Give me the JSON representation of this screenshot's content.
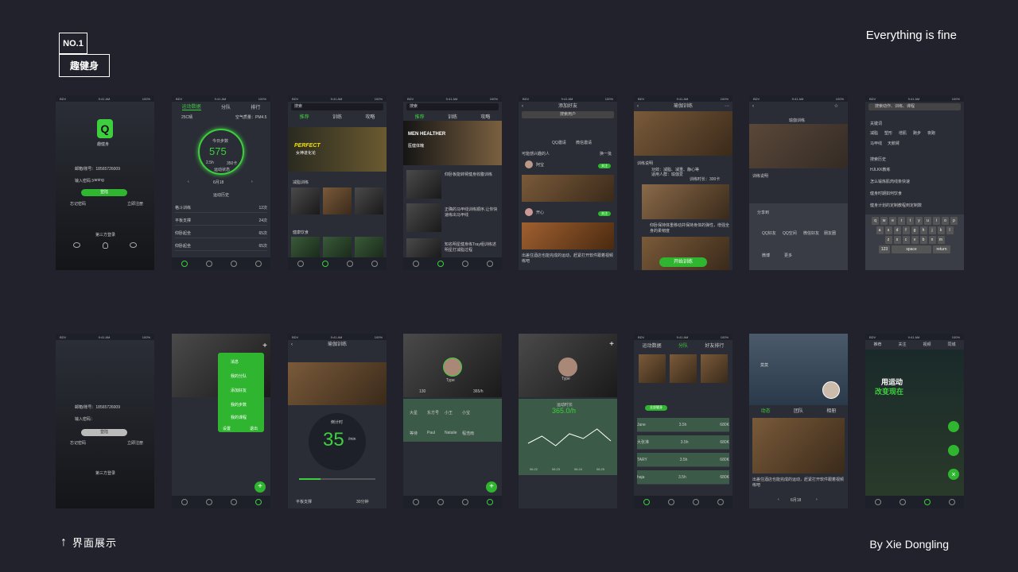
{
  "header": {
    "no_label": "NO.1",
    "app_name": "趣健身",
    "tagline": "Everything is fine"
  },
  "footer": {
    "section_label": "界面展示",
    "author": "By Xie Dongling"
  },
  "status": {
    "carrier": "BDV",
    "time": "9:41 AM",
    "battery": "100%"
  },
  "login": {
    "logo": "Q",
    "app": "趣健身",
    "account": "邮箱/账号：18565726009",
    "password_label": "输入密码：",
    "password": "yaning",
    "login_btn": "登陆",
    "forgot": "忘记密码",
    "register": "立即注册",
    "third": "第三方登录"
  },
  "stats": {
    "tabs": [
      "运动数据",
      "分队",
      "排行"
    ],
    "weather": "25C晴",
    "air": "空气质量：PM4.5",
    "today": "今日步数",
    "steps": "575",
    "dist": "2.5h",
    "cal": "350卡",
    "mode": "运动状态",
    "date": "6月18",
    "history": "运动历史",
    "items": [
      {
        "n": "格斗训练",
        "v": "12次"
      },
      {
        "n": "平板支撑",
        "v": "24次"
      },
      {
        "n": "仰卧起坐",
        "v": "65次"
      },
      {
        "n": "仰卧起坐",
        "v": "65次"
      }
    ]
  },
  "discover": {
    "search": "搜索",
    "tabs": [
      "推荐",
      "训练",
      "攻略"
    ],
    "banner": "PERFECT",
    "banner2": "女神进化论",
    "sec1": "减脂训练",
    "sec2": "健康饮食"
  },
  "recommend": {
    "search": "搜索",
    "tabs": [
      "推荐",
      "训练",
      "攻略"
    ],
    "banner": "MEN HEALTHER",
    "banner2": "医健体魄",
    "items": [
      "仰卧板能转臂健身收腹训练",
      "正确的马甲线训练顺序,让你快速练出马甲线",
      "知名明星健身练Tray组训练述明星打减脂过程"
    ]
  },
  "friends": {
    "title": "添加好友",
    "search": "搜索用户",
    "qq": "QQ邀请",
    "wx": "微信邀请",
    "maybe": "可能感兴趣的人",
    "change": "换一批",
    "p1": "阿宝",
    "p2": "开心",
    "add": "关注",
    "caption": "出差住酒店也能完成的运动，赶紧打开软件跟着视频练吧"
  },
  "yoga": {
    "title": "瑜伽训练",
    "desc": "训练说明",
    "effect": "功效：减脂、减重、静心等",
    "people": "适用人群：瑜伽爱",
    "time": "训练时长：300卡",
    "step2": "仰卧保持体重移动并保持身体的弹性，增强全身的柔韧度",
    "start": "开始训练"
  },
  "share": {
    "title": "瑜伽训练",
    "desc": "训练说明",
    "share_to": "分享到",
    "items": [
      "QQ好友",
      "QQ空间",
      "微信好友",
      "朋友圈",
      "微博",
      "更多"
    ]
  },
  "search": {
    "placeholder": "搜索动作、训练、课程",
    "hot": "关键词",
    "tags": [
      "减脂",
      "塑形",
      "增肌",
      "跑步",
      "夜跑",
      "马甲线",
      "天鹅臂"
    ],
    "history": "搜索历史",
    "h": [
      "HJLKK教练",
      "怎么锻炼肌肉线条快速",
      "健身时期如何饮食",
      "健身计划的定制教程到定制数"
    ],
    "rows": [
      "qwertyuiop",
      "asdfghjkl",
      "zxcvbnm"
    ],
    "space": "space",
    "ret": "return",
    "num": "123"
  },
  "menu": {
    "items": [
      "消息",
      "我的分队",
      "添加好友",
      "我的步数",
      "我的课程"
    ],
    "settings": "设置",
    "logout": "退出"
  },
  "timer": {
    "title": "瑜伽训练",
    "count": "倒计时",
    "value": "35",
    "unit": "/min",
    "exercise": "平板支撑",
    "duration": "30分钟"
  },
  "profile": {
    "name": "Type",
    "f1": "130",
    "f2": "365/h",
    "friends": [
      "大星",
      "东方号",
      "小王",
      "小宝",
      "等待",
      "Paul",
      "Natalie",
      "程浩雨"
    ]
  },
  "graph": {
    "name": "Type",
    "label": "运动时长",
    "value": "365.0/h",
    "xs": [
      "06.22",
      "06.23",
      "06.24",
      "06.25"
    ],
    "ys": [
      40,
      55,
      35,
      60,
      50,
      70,
      45
    ]
  },
  "team": {
    "tabs": [
      "运动数据",
      "分队",
      "好友排行"
    ],
    "filter": "全部健身",
    "pop": "全部健身",
    "members": [
      {
        "n": "Jane",
        "h": "3.5h",
        "k": "680K"
      },
      {
        "n": "大张准",
        "h": "3.5h",
        "k": "680K"
      },
      {
        "n": "TARY",
        "h": "3.5h",
        "k": "680K"
      },
      {
        "n": "haja",
        "h": "3.5h",
        "k": "680K"
      }
    ]
  },
  "gym": {
    "name": "莫莫",
    "tabs": [
      "动态",
      "团队",
      "相册"
    ],
    "caption": "出差住酒店也能完成的运动，赶紧打开软件跟着视频练吧",
    "date": "6月18"
  },
  "feed": {
    "tabs": [
      "推荐",
      "关注",
      "视频",
      "同城"
    ],
    "slogan": "用运动",
    "slogan2": "改变现在"
  }
}
